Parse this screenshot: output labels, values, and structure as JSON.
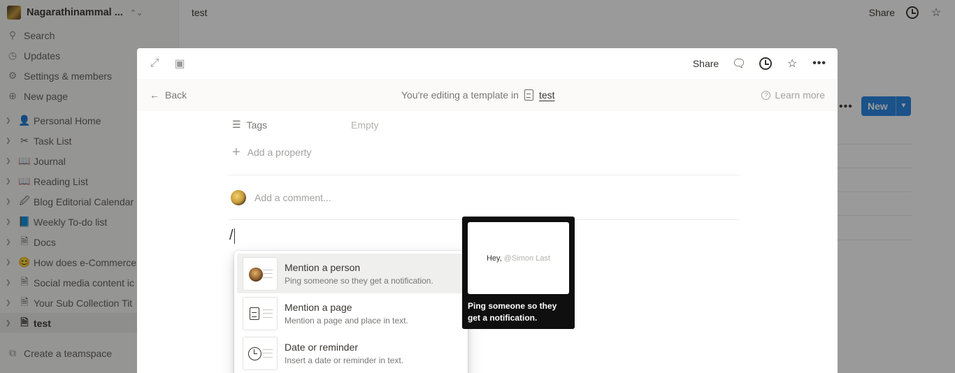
{
  "workspace": {
    "name": "Nagarathinammal ..."
  },
  "sidebar": {
    "actions": [
      {
        "label": "Search",
        "icon": "search-icon"
      },
      {
        "label": "Updates",
        "icon": "clock-icon"
      },
      {
        "label": "Settings & members",
        "icon": "gear-icon"
      },
      {
        "label": "New page",
        "icon": "plus-circle-icon"
      }
    ],
    "pages": [
      {
        "label": "Personal Home",
        "icon": "👤"
      },
      {
        "label": "Task List",
        "icon": "✂"
      },
      {
        "label": "Journal",
        "icon": "📖"
      },
      {
        "label": "Reading List",
        "icon": "📖"
      },
      {
        "label": "Blog Editorial Calendar",
        "icon": "🖉"
      },
      {
        "label": "Weekly To-do list",
        "icon": "📘"
      },
      {
        "label": "Docs",
        "icon": "🗎"
      },
      {
        "label": "How does e-Commerce",
        "icon": "😊"
      },
      {
        "label": "Social media content ic",
        "icon": "🗎"
      },
      {
        "label": "Your Sub Collection Tit",
        "icon": "🗎"
      },
      {
        "label": "test",
        "icon": "🗎"
      }
    ],
    "create_teamspace": "Create a teamspace"
  },
  "topbar": {
    "breadcrumb": "test",
    "share": "Share"
  },
  "background": {
    "new_button": "New"
  },
  "modal": {
    "share": "Share",
    "template_bar": {
      "back": "Back",
      "editing_text": "You're editing a template in",
      "template_link": "test",
      "learn_more": "Learn more"
    },
    "properties": [
      {
        "name": "Tags",
        "value": "Empty"
      }
    ],
    "add_property": "Add a property",
    "comment_placeholder": "Add a comment...",
    "editor_text": "/"
  },
  "mention_menu": {
    "items": [
      {
        "title": "Mention a person",
        "desc": "Ping someone so they get a notification."
      },
      {
        "title": "Mention a page",
        "desc": "Mention a page and place in text."
      },
      {
        "title": "Date or reminder",
        "desc": "Insert a date or reminder in text."
      }
    ]
  },
  "preview": {
    "greeting": "Hey,",
    "mention": "@Simon Last",
    "caption": "Ping someone so they get a notification."
  },
  "colors": {
    "accent": "#2383e2",
    "tooltip_bg": "#0f0f0f"
  }
}
